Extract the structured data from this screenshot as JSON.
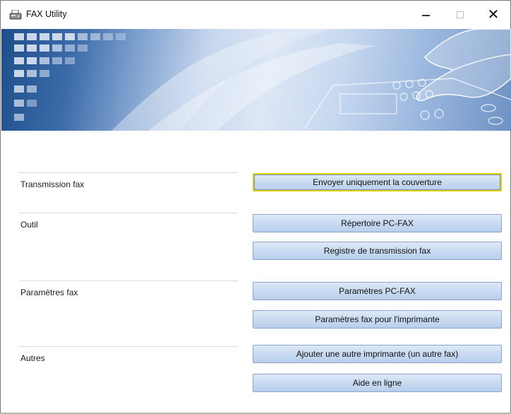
{
  "window": {
    "title": "FAX Utility",
    "icon": "fax-machine-icon",
    "controls": {
      "minimize_glyph": "—",
      "close_glyph": "✕"
    }
  },
  "banner": {
    "colors": {
      "deep": "#1f4f8a",
      "light": "#dde7f5",
      "accent": "#6e92c4"
    }
  },
  "sections": [
    {
      "label": "Transmission fax",
      "buttons": [
        "Envoyer uniquement la couverture"
      ]
    },
    {
      "label": "Outil",
      "buttons": [
        "Répertoire PC-FAX",
        "Registre de transmission fax"
      ]
    },
    {
      "label": "Paramètres fax",
      "buttons": [
        "Paramètres PC-FAX",
        "Paramètres fax pour l'imprimante"
      ]
    },
    {
      "label": "Autres",
      "buttons": [
        "Ajouter une autre imprimante (un autre fax)",
        "Aide en ligne"
      ]
    }
  ],
  "focus_color": "#e4d100"
}
